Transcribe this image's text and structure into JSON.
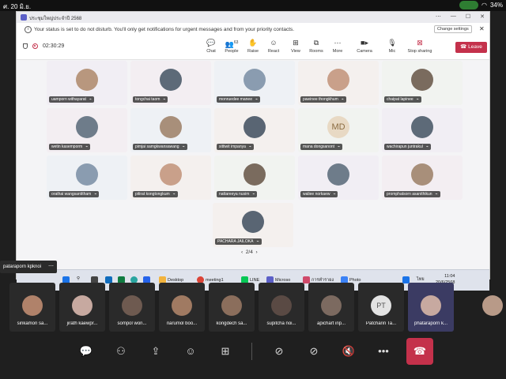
{
  "phone_status": {
    "time": "ศ. 20 มิ.ย.",
    "battery": "34%"
  },
  "teams": {
    "title": "ประชุมใหญ่ประจำปี 2568",
    "dnd_message": "Your status is set to do not disturb. You'll only get notifications for urgent messages and from your priority contacts.",
    "dnd_button": "Change settings",
    "timer": "02:30:29",
    "toolbar": [
      {
        "label": "Chat",
        "icon": "chat-icon"
      },
      {
        "label": "People",
        "icon": "people-icon",
        "badge": "63"
      },
      {
        "label": "Raise",
        "icon": "raise-hand-icon"
      },
      {
        "label": "React",
        "icon": "react-icon"
      },
      {
        "label": "View",
        "icon": "view-icon"
      },
      {
        "label": "Rooms",
        "icon": "rooms-icon"
      },
      {
        "label": "More",
        "icon": "more-icon"
      },
      {
        "label": "Camera",
        "icon": "camera-icon"
      },
      {
        "label": "Mic",
        "icon": "mic-icon"
      },
      {
        "label": "Stop sharing",
        "icon": "stop-sharing-icon"
      }
    ],
    "leave_label": "Leave",
    "participants": [
      "uamporn withayarat",
      "tongchai taom",
      "monruedee manee",
      "pawinee thongkhum",
      "chaipat lapinee",
      "wetin kasemporm",
      "pimjai samgkwansawang",
      "sittiwit impanya",
      "mana dongsanont",
      "wachirapun juntrakul",
      "orathai wangsantitham",
      "pitirat kongtongkum",
      "nattareeya nusim",
      "waliee norkaew",
      "promphatsorn asanithikun",
      "PACHARA JAILOKA"
    ],
    "initials_tile": "MD",
    "pager": "2/4",
    "taskbar": {
      "apps": [
        "Desktop",
        "meeting1",
        "LINE",
        "Microso",
        "การทำรายง",
        "Photo"
      ],
      "lang": "ไทย",
      "clock": "11:04",
      "date": "20/6/2568"
    }
  },
  "presenter": "pataraporn kpknoi",
  "filmstrip": [
    {
      "name": "sirikamon sa..."
    },
    {
      "name": "jirath kaewpr..."
    },
    {
      "name": "sompol won..."
    },
    {
      "name": "narumol boo..."
    },
    {
      "name": "kongdech sa..."
    },
    {
      "name": "supitcha noi..."
    },
    {
      "name": "apichart inp..."
    },
    {
      "name": "Patcharin Ta...",
      "initials": "PT"
    },
    {
      "name": "phataraporn k..."
    }
  ],
  "controls": [
    "chat-icon",
    "people-icon",
    "share-icon",
    "effects-icon",
    "apps-icon",
    "camera-off-icon",
    "mic-off-icon",
    "speaker-off-icon",
    "more-icon",
    "end-call-icon"
  ]
}
